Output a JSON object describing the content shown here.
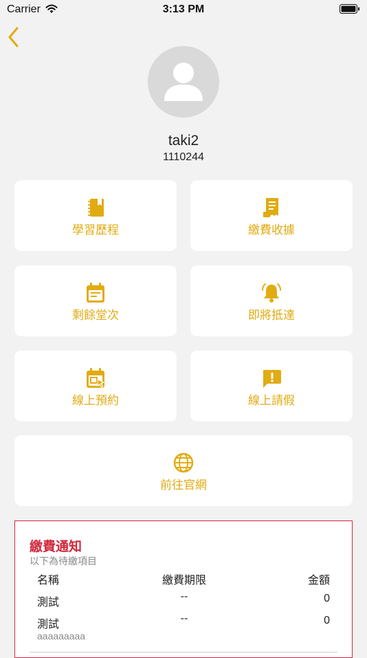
{
  "status_bar": {
    "carrier": "Carrier",
    "time": "3:13 PM"
  },
  "profile": {
    "username": "taki2",
    "user_id": "1110244"
  },
  "menu": [
    {
      "label": "學習歷程",
      "icon": "notebook-icon"
    },
    {
      "label": "繳費收據",
      "icon": "receipt-icon"
    },
    {
      "label": "剩餘堂次",
      "icon": "calendar-icon"
    },
    {
      "label": "即將抵達",
      "icon": "bell-icon"
    },
    {
      "label": "線上預約",
      "icon": "calendar-select-icon"
    },
    {
      "label": "線上請假",
      "icon": "alert-message-icon"
    },
    {
      "label": "前往官網",
      "icon": "globe-icon"
    }
  ],
  "payment_notice": {
    "title": "繳費通知",
    "subtitle": "以下為待繳項目",
    "columns": [
      "名稱",
      "繳費期限",
      "金額"
    ],
    "rows": [
      {
        "name": "測試",
        "note": "",
        "deadline": "--",
        "amount": "0"
      },
      {
        "name": "測試",
        "note": "aaaaaaaaa",
        "deadline": "--",
        "amount": "0"
      }
    ]
  },
  "colors": {
    "accent": "#E1AB12",
    "alert": "#D0283C",
    "background": "#F2F2F2"
  }
}
